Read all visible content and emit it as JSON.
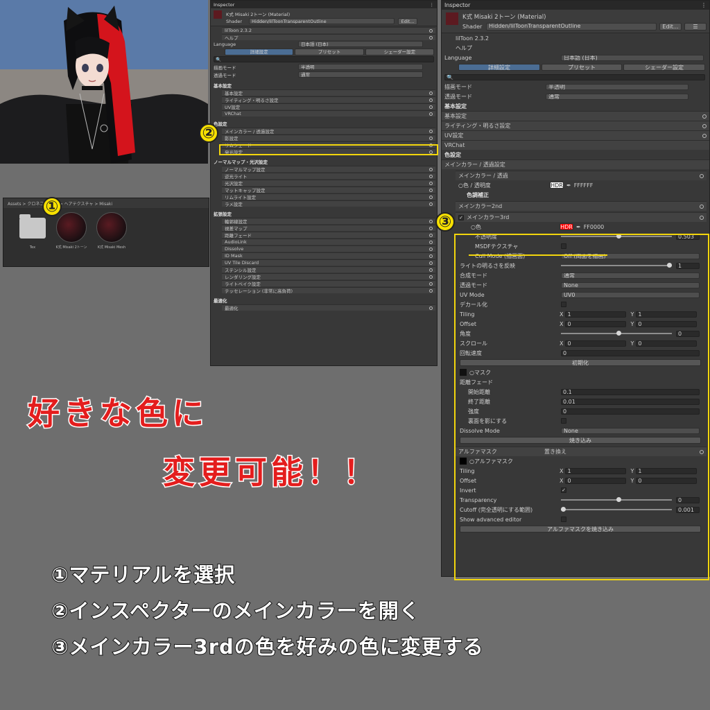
{
  "viewport": {
    "label": "3D viewport - avatar model"
  },
  "project": {
    "breadcrumb": "Assets > クロネコ... > 改 > ヘアテクスチャ > Misaki",
    "assets": [
      {
        "label": "Tex",
        "kind": "folder"
      },
      {
        "label": "K式 Misaki 2トーン",
        "kind": "material"
      },
      {
        "label": "K式 Misaki Mesh",
        "kind": "material"
      }
    ]
  },
  "inspector_small": {
    "tab": "Inspector",
    "title": "K式 Misaki 2トーン (Material)",
    "shader_label": "Shader",
    "shader": "Hidden/lilToonTransparentOutline",
    "edit": "Edit...",
    "rows": [
      {
        "t": "fold",
        "label": "lilToon 2.3.2"
      },
      {
        "t": "fold",
        "label": "ヘルプ"
      },
      {
        "t": "kv",
        "label": "Language",
        "value": "日本語 (日本)"
      },
      {
        "t": "tabs",
        "items": [
          "詳細設定",
          "プリセット",
          "シェーダー設定"
        ]
      },
      {
        "t": "search"
      },
      {
        "t": "kv",
        "label": "描画モード",
        "value": "半透明"
      },
      {
        "t": "kv",
        "label": "透過モード",
        "value": "通常"
      },
      {
        "t": "sect",
        "label": "基本設定"
      },
      {
        "t": "fold",
        "label": "基本設定"
      },
      {
        "t": "fold",
        "label": "ライティング・明るさ設定"
      },
      {
        "t": "fold",
        "label": "UV設定"
      },
      {
        "t": "fold",
        "label": "VRChat"
      },
      {
        "t": "sect",
        "label": "色設定"
      },
      {
        "t": "fold",
        "label": "メインカラー / 透過設定",
        "hl": true
      },
      {
        "t": "fold",
        "label": "影設定"
      },
      {
        "t": "fold",
        "label": "リムシェード"
      },
      {
        "t": "fold",
        "label": "発光設定"
      },
      {
        "t": "sect",
        "label": "ノーマルマップ・光沢設定"
      },
      {
        "t": "fold",
        "label": "ノーマルマップ設定"
      },
      {
        "t": "fold",
        "label": "逆光ライト"
      },
      {
        "t": "fold",
        "label": "光沢設定"
      },
      {
        "t": "fold",
        "label": "マットキャップ設定"
      },
      {
        "t": "fold",
        "label": "リムライト設定"
      },
      {
        "t": "fold",
        "label": "ラメ設定"
      },
      {
        "t": "sect",
        "label": "拡張設定"
      },
      {
        "t": "fold",
        "label": "輪郭線設定"
      },
      {
        "t": "fold",
        "label": "視差マップ"
      },
      {
        "t": "fold",
        "label": "距離フェード"
      },
      {
        "t": "fold",
        "label": "AudioLink"
      },
      {
        "t": "fold",
        "label": "Dissolve"
      },
      {
        "t": "fold",
        "label": "ID Mask"
      },
      {
        "t": "fold",
        "label": "UV Tile Discard"
      },
      {
        "t": "fold",
        "label": "ステンシル設定"
      },
      {
        "t": "fold",
        "label": "レンダリング設定"
      },
      {
        "t": "fold",
        "label": "ライトベイク設定"
      },
      {
        "t": "fold",
        "label": "テッセレーション (非常に高負荷)"
      },
      {
        "t": "sect",
        "label": "最適化"
      },
      {
        "t": "fold",
        "label": "最適化"
      }
    ]
  },
  "inspector_big": {
    "tab": "Inspector",
    "title": "K式 Misaki 2トーン (Material)",
    "shader_label": "Shader",
    "shader": "Hidden/lilToonTransparentOutline",
    "edit": "Edit...",
    "version": "lilToon 2.3.2",
    "help": "ヘルプ",
    "language_label": "Language",
    "language": "日本語 (日本)",
    "tabs": [
      "詳細設定",
      "プリセット",
      "シェーダー設定"
    ],
    "render_mode_label": "描画モード",
    "render_mode": "半透明",
    "trans_mode_label": "透過モード",
    "trans_mode": "通常",
    "basic_sect": "基本設定",
    "basic": [
      "基本設定",
      "ライティング・明るさ設定",
      "UV設定",
      "VRChat"
    ],
    "color_sect": "色設定",
    "main_color_fold": "メインカラー / 透過設定",
    "main_color_sub": "メインカラー / 透過",
    "color_alpha": "○色 / 透明度",
    "hdr": "HDR",
    "white": "FFFFFF",
    "color_adjust": "色調補正",
    "main2nd": "メインカラー2nd",
    "main3rd": "メインカラー3rd",
    "color": "○色",
    "hex_red": "FF0000",
    "opacity_label": "不透明度",
    "opacity": "0.503",
    "msdf": "MSDFテクスチャ",
    "cull_label": "Cull Mode (描画面)",
    "cull": "Off (両面を描画)",
    "invert_light_label": "ライトの明るさを反映",
    "invert_light": "1",
    "blend_label": "合成モード",
    "blend": "通常",
    "trans2_label": "透過モード",
    "trans2": "None",
    "uvmode_label": "UV Mode",
    "uvmode": "UV0",
    "decal": "デカール化",
    "tiling": "Tiling",
    "offset": "Offset",
    "x1": "1",
    "y1": "1",
    "x0": "0",
    "y0": "0",
    "angle_label": "角度",
    "angle": "0",
    "scroll_label": "スクロール",
    "rot_label": "回転速度",
    "rot": "0",
    "init": "初期化",
    "mask": "○マスク",
    "dist_fade": "距離フェード",
    "fade_start_label": "開始距離",
    "fade_start": "0.1",
    "fade_end_label": "終了距離",
    "fade_end": "0.01",
    "strength_label": "強度",
    "strength": "0",
    "backface": "裏面を影にする",
    "dissolve_label": "Dissolve Mode",
    "dissolve": "None",
    "bake": "焼き込み",
    "alphamask_label": "アルファマスク",
    "alphamask": "置き換え",
    "alphamask_tex": "○アルファマスク",
    "am_tiling": "Tiling",
    "am_offset": "Offset",
    "invert": "Invert",
    "transparency_label": "Transparency",
    "transparency": "0",
    "cutoff_label": "Cutoff (完全透明にする範囲)",
    "cutoff": "0.001",
    "advanced": "Show advanced editor",
    "am_bake": "アルファマスクを焼き込み"
  },
  "callouts": {
    "n1": "①",
    "n2": "②",
    "n3": "③"
  },
  "headline": {
    "line1": "好きな色に",
    "line2": "変更可能！！"
  },
  "steps": [
    "①マテリアルを選択",
    "②インスペクターのメインカラーを開く",
    "③メインカラー3rdの色を好みの色に変更する"
  ],
  "colors": {
    "highlight": "#f3d60c",
    "accent_red": "#ff0000",
    "headline_red": "#e41d1d"
  }
}
